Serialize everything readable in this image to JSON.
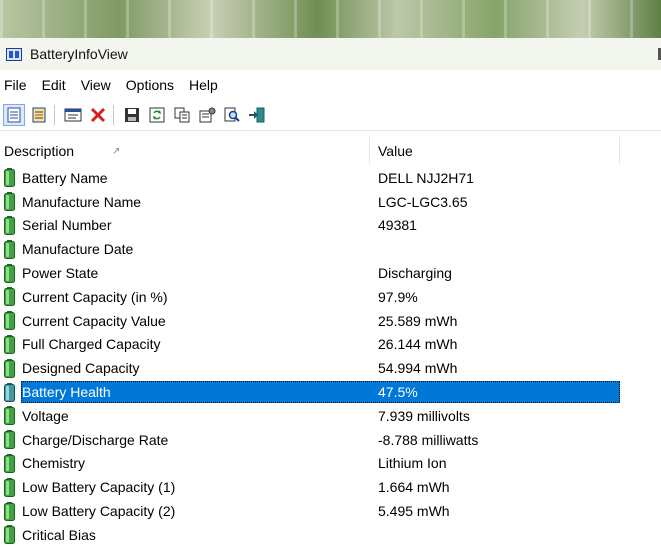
{
  "window": {
    "title": "BatteryInfoView"
  },
  "menu": [
    "File",
    "Edit",
    "View",
    "Options",
    "Help"
  ],
  "toolbar": {
    "buttons": [
      {
        "name": "html-report-icon",
        "active": true
      },
      {
        "name": "html-report-all-icon",
        "active": false
      },
      {
        "name": "properties-window-icon",
        "active": false
      },
      {
        "name": "delete-icon",
        "active": false
      },
      {
        "name": "save-icon",
        "active": false
      },
      {
        "name": "refresh-icon",
        "active": false
      },
      {
        "name": "copy-icon",
        "active": false
      },
      {
        "name": "properties-icon",
        "active": false
      },
      {
        "name": "find-icon",
        "active": false
      },
      {
        "name": "exit-icon",
        "active": false
      }
    ]
  },
  "columns": {
    "description": "Description",
    "value": "Value"
  },
  "rows": [
    {
      "description": "Battery Name",
      "value": "DELL NJJ2H71"
    },
    {
      "description": "Manufacture Name",
      "value": "LGC-LGC3.65"
    },
    {
      "description": "Serial Number",
      "value": "49381"
    },
    {
      "description": "Manufacture Date",
      "value": ""
    },
    {
      "description": "Power State",
      "value": "Discharging"
    },
    {
      "description": "Current Capacity (in %)",
      "value": "97.9%"
    },
    {
      "description": "Current Capacity Value",
      "value": "25.589 mWh"
    },
    {
      "description": "Full Charged Capacity",
      "value": "26.144 mWh"
    },
    {
      "description": "Designed Capacity",
      "value": "54.994 mWh"
    },
    {
      "description": "Battery Health",
      "value": "47.5%",
      "selected": true
    },
    {
      "description": "Voltage",
      "value": "7.939 millivolts"
    },
    {
      "description": "Charge/Discharge Rate",
      "value": "-8.788 milliwatts"
    },
    {
      "description": "Chemistry",
      "value": "Lithium Ion"
    },
    {
      "description": "Low Battery Capacity (1)",
      "value": "1.664 mWh"
    },
    {
      "description": "Low Battery Capacity (2)",
      "value": "5.495 mWh"
    },
    {
      "description": "Critical Bias",
      "value": ""
    }
  ],
  "colors": {
    "selection": "#0078d7",
    "battery_green": "#2e8b2e"
  }
}
